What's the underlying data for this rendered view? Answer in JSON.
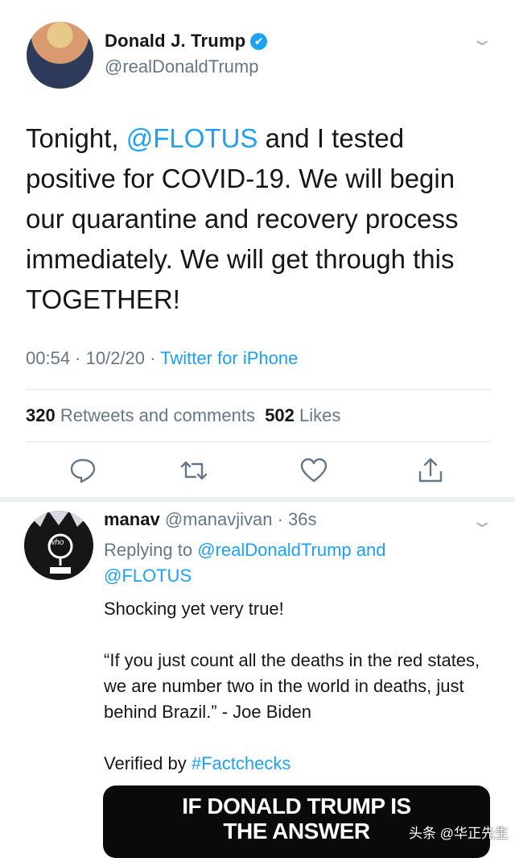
{
  "tweet": {
    "author_name": "Donald J. Trump",
    "verified_icon": "✔",
    "handle": "@realDonaldTrump",
    "text_before": "Tonight, ",
    "mention": "@FLOTUS",
    "text_after": " and I tested positive for COVID-19. We will begin our quarantine and recovery process immediately. We will get through this TOGETHER!",
    "time_date": "00:54 · 10/2/20 · ",
    "source": "Twitter for iPhone",
    "retweets_count": "320",
    "retweets_label": "Retweets and comments",
    "likes_count": "502",
    "likes_label": "Likes",
    "menu_icon": "chevron-down"
  },
  "reply": {
    "author_name": "manav",
    "handle_time": "@manavjivan · 36s",
    "replying_prefix": "Replying to ",
    "replying_users": "@realDonaldTrump and @FLOTUS",
    "line1": "Shocking yet very true!",
    "quote": "“If you just count all the deaths in the red states, we are number two in the world in deaths, just behind Brazil.” - Joe Biden",
    "verified_by": "Verified by ",
    "hashtag": "#Factchecks",
    "media_line1": "IF DONALD TRUMP IS",
    "media_line2": "THE ANSWER",
    "avatar_text": "who"
  },
  "watermark": "头条 @华正先生",
  "colors": {
    "accent": "#1da1f2",
    "muted": "#657786",
    "text": "#14171a"
  }
}
